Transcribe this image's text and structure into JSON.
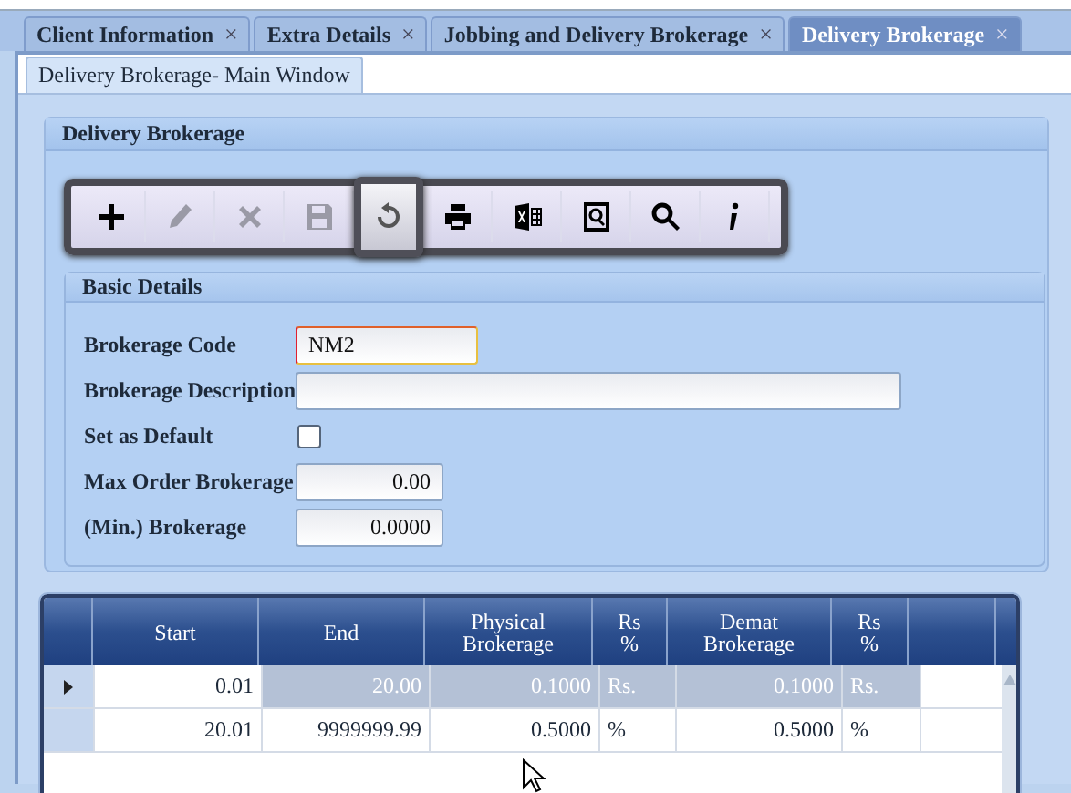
{
  "tabs": [
    {
      "label": "Client Information",
      "close": "×",
      "selected": false
    },
    {
      "label": "Extra Details",
      "close": "×",
      "selected": false
    },
    {
      "label": "Jobbing and Delivery Brokerage",
      "close": "×",
      "selected": false
    },
    {
      "label": "Delivery Brokerage",
      "close": "×",
      "selected": true
    }
  ],
  "subtabs": [
    {
      "label": "Delivery Brokerage- Main Window",
      "selected": true
    }
  ],
  "group_title": "Delivery Brokerage",
  "toolbar": [
    {
      "kind": "add",
      "disabled": false,
      "highlighted": false
    },
    {
      "kind": "edit",
      "disabled": true,
      "highlighted": false
    },
    {
      "kind": "delete",
      "disabled": true,
      "highlighted": false
    },
    {
      "kind": "save",
      "disabled": true,
      "highlighted": false
    },
    {
      "kind": "refresh",
      "disabled": true,
      "highlighted": true
    },
    {
      "kind": "print",
      "disabled": false,
      "highlighted": false
    },
    {
      "kind": "excel",
      "disabled": false,
      "highlighted": false
    },
    {
      "kind": "preview",
      "disabled": false,
      "highlighted": false
    },
    {
      "kind": "search",
      "disabled": false,
      "highlighted": false
    },
    {
      "kind": "info",
      "disabled": false,
      "highlighted": false
    }
  ],
  "basic_details": {
    "title": "Basic Details",
    "fields": [
      {
        "kind": "text",
        "label": "Brokerage Code",
        "value": "NM2",
        "focused": true
      },
      {
        "kind": "wide",
        "label": "Brokerage Description",
        "focused": false
      },
      {
        "kind": "checkbox",
        "label": "Set as Default",
        "checked": false
      },
      {
        "kind": "number",
        "label": "Max Order Brokerage",
        "value": "0.00",
        "focused": false
      },
      {
        "kind": "number",
        "label": "(Min.) Brokerage",
        "value": "0.0000",
        "focused": false
      }
    ]
  },
  "table": {
    "columns": [
      "Start",
      "End",
      "Physical Brokerage",
      "Rs %",
      "Demat Brokerage",
      "Rs %"
    ],
    "rows": [
      {
        "current": true,
        "selected": true,
        "cells": [
          "0.01",
          "20.00",
          "0.1000",
          "Rs.",
          "0.1000",
          "Rs."
        ]
      },
      {
        "current": false,
        "selected": false,
        "cells": [
          "20.01",
          "9999999.99",
          "0.5000",
          "%",
          "0.5000",
          "%"
        ]
      }
    ]
  }
}
